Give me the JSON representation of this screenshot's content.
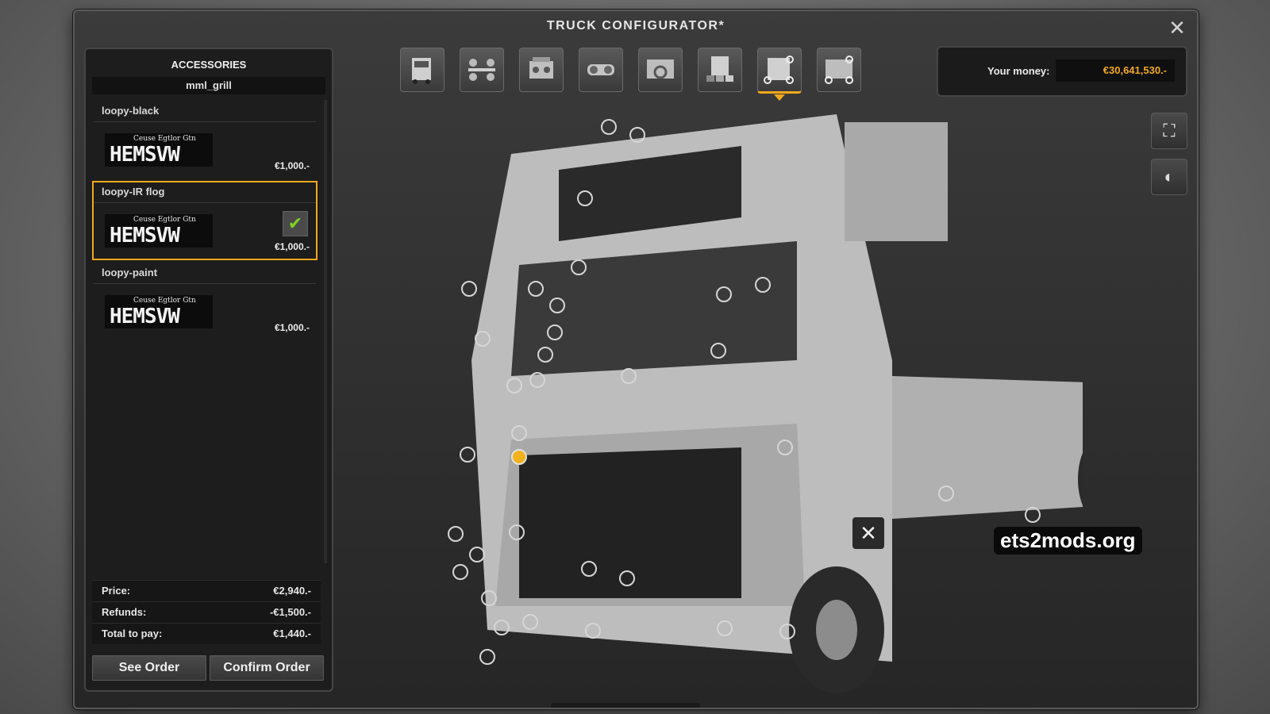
{
  "window": {
    "title": "TRUCK CONFIGURATOR*",
    "close_icon": "close-icon"
  },
  "left_panel": {
    "heading": "ACCESSORIES",
    "category": "mml_grill",
    "items": [
      {
        "name": "loopy-black",
        "price": "€1,000.-",
        "selected": false,
        "thumb_small": "Ceuse Egtlor Gtn",
        "thumb_big": "HEMSVW"
      },
      {
        "name": "loopy-IR flog",
        "price": "€1,000.-",
        "selected": true,
        "thumb_small": "Ceuse Egtlor Gtn",
        "thumb_big": "HEMSVW"
      },
      {
        "name": "loopy-paint",
        "price": "€1,000.-",
        "selected": false,
        "thumb_small": "Ceuse Egtlor Gtn",
        "thumb_big": "HEMSVW"
      }
    ],
    "summary": {
      "price_label": "Price:",
      "price_value": "€2,940.-",
      "refunds_label": "Refunds:",
      "refunds_value": "-€1,500.-",
      "total_label": "Total to pay:",
      "total_value": "€1,440.-"
    },
    "buttons": {
      "see_order": "See Order",
      "confirm_order": "Confirm Order"
    }
  },
  "tabs": [
    {
      "name": "tab-truck",
      "icon": "truck-icon"
    },
    {
      "name": "tab-chassis",
      "icon": "chassis-icon"
    },
    {
      "name": "tab-engine",
      "icon": "engine-icon"
    },
    {
      "name": "tab-transmission",
      "icon": "transmission-icon"
    },
    {
      "name": "tab-interior",
      "icon": "interior-icon"
    },
    {
      "name": "tab-paint",
      "icon": "paint-icon"
    },
    {
      "name": "tab-accessories",
      "icon": "accessories-icon",
      "active": true
    },
    {
      "name": "tab-interior-accessories",
      "icon": "interior-accessories-icon"
    }
  ],
  "money": {
    "label": "Your money:",
    "value": "€30,641,530.-",
    "accent": "#f2a81d"
  },
  "side_buttons": {
    "fullscreen_icon": "fullscreen-icon",
    "lights_icon": "headlights-icon"
  },
  "watermark": "ets2mods.org"
}
